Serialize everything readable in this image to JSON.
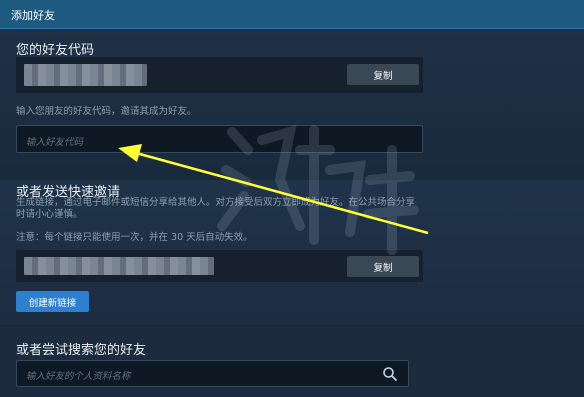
{
  "titlebar": {
    "title": "添加好友"
  },
  "friend_code": {
    "heading": "您的好友代码",
    "copy_label": "复制",
    "hint": "输入您朋友的好友代码，邀请其成为好友。",
    "input_placeholder": "输入好友代码"
  },
  "quick_invite": {
    "heading": "或者发送快速邀请",
    "description": "生成链接，通过电子邮件或短信分享给其他人。对方接受后双方立即成为好友。在公共场合分享时请小心谨慎。",
    "note": "注意：每个链接只能使用一次，并在 30 天后自动失效。",
    "copy_label": "复制",
    "create_label": "创建新链接"
  },
  "search": {
    "heading": "或者尝试搜索您的好友",
    "placeholder": "输入好友的个人资料名称"
  },
  "colors": {
    "accent": "#2d7fd0",
    "titlebar": "#1e5a80",
    "background": "#1b2838",
    "annotation_arrow": "#ffff33"
  }
}
